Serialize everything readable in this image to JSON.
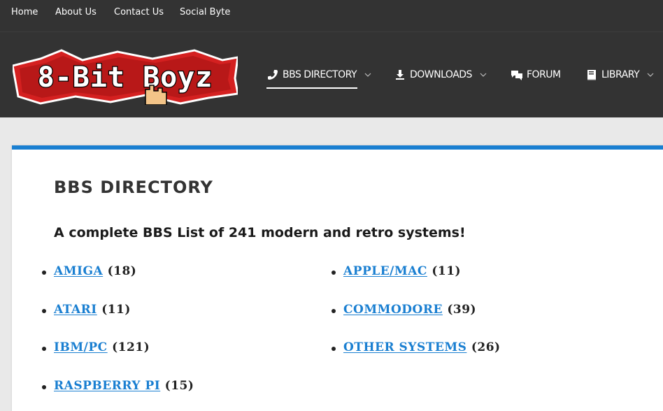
{
  "topbar": {
    "links": [
      "Home",
      "About Us",
      "Contact Us",
      "Social Byte"
    ]
  },
  "logo": {
    "alt": "8-Bit Boyz"
  },
  "nav": {
    "bbs_directory": "BBS DIRECTORY",
    "downloads": "DOWNLOADS",
    "forum": "FORUM",
    "library": "LIBRARY"
  },
  "page": {
    "title": "BBS DIRECTORY",
    "subtitle": "A complete BBS List of 241 modern and retro systems!"
  },
  "categories": [
    {
      "name": "AMIGA",
      "count": "(18)"
    },
    {
      "name": "APPLE/MAC",
      "count": "(11)"
    },
    {
      "name": "ATARI",
      "count": "(11)"
    },
    {
      "name": "COMMODORE",
      "count": "(39)"
    },
    {
      "name": "IBM/PC",
      "count": "(121)"
    },
    {
      "name": "OTHER SYSTEMS",
      "count": "(26)"
    },
    {
      "name": "RASPBERRY PI",
      "count": "(15)"
    }
  ],
  "colors": {
    "accent": "#1a7fd1",
    "header_bg": "#333333",
    "page_bg": "#e9e9e9"
  },
  "icons": {
    "bbs_directory": "phone-icon",
    "downloads": "download-icon",
    "forum": "chat-bubbles-icon",
    "library": "book-icon"
  }
}
